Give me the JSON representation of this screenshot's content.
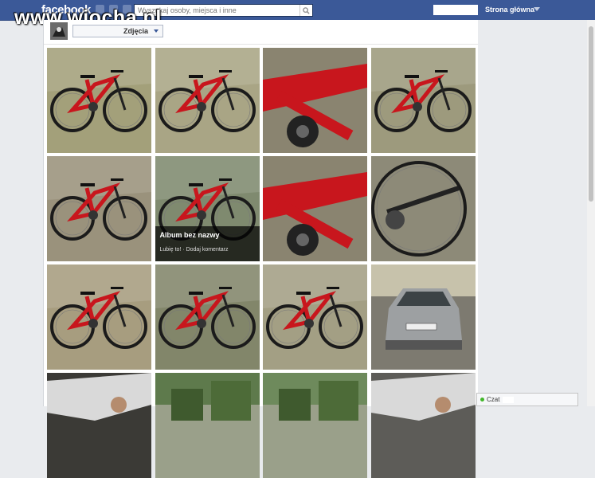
{
  "topbar": {
    "logo": "facebook",
    "search_placeholder": "Wyszukaj osoby, miejsca i inne",
    "home_link": "Strona główna"
  },
  "watermark": "www.wiocha.pl",
  "album": {
    "selector_label": "Zdjęcia"
  },
  "photos": [
    {
      "id": 1,
      "bg": "#a3a07a",
      "subject": "bike"
    },
    {
      "id": 2,
      "bg": "#a9a585",
      "subject": "bike"
    },
    {
      "id": 3,
      "bg": "#b0a783",
      "subject": "bike-closeup"
    },
    {
      "id": 4,
      "bg": "#9d9a7d",
      "subject": "bike"
    },
    {
      "id": 5,
      "bg": "#9a927c",
      "subject": "bike"
    },
    {
      "id": 6,
      "bg": "#7f8a6f",
      "subject": "bike"
    },
    {
      "id": 7,
      "bg": "#6f6e60",
      "subject": "bike-closeup"
    },
    {
      "id": 8,
      "bg": "#8d8a78",
      "subject": "bike-wheel"
    },
    {
      "id": 9,
      "bg": "#a79d7f",
      "subject": "bike"
    },
    {
      "id": 10,
      "bg": "#82866a",
      "subject": "bike"
    },
    {
      "id": 11,
      "bg": "#a39f84",
      "subject": "bike"
    },
    {
      "id": 12,
      "bg": "#7d7a70",
      "subject": "car"
    },
    {
      "id": 13,
      "bg": "#3b3a36",
      "subject": "car-interior"
    },
    {
      "id": 14,
      "bg": "#5e7a4c",
      "subject": "street"
    },
    {
      "id": 15,
      "bg": "#6e8a5c",
      "subject": "street"
    },
    {
      "id": 16,
      "bg": "#5d5c58",
      "subject": "car-interior"
    }
  ],
  "overlay": {
    "title": "Album bez nazwy",
    "like": "Lubię to!",
    "separator": " · ",
    "comment": "Dodaj komentarz"
  },
  "chat": {
    "label": "Czat"
  },
  "colors": {
    "brand": "#3b5998",
    "bike_red": "#c8161d",
    "online": "#42b72a"
  }
}
